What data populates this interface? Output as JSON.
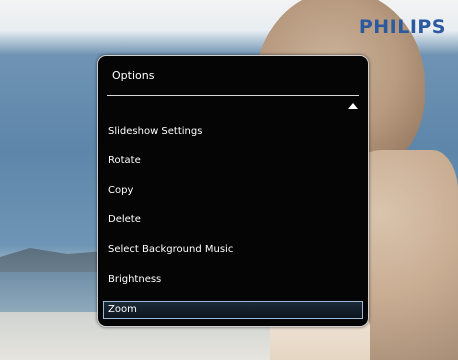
{
  "brand": {
    "name": "PHILIPS",
    "color": "#2b5aa0"
  },
  "menu": {
    "title": "Options",
    "scroll_indicator": "up-arrow-icon",
    "items": [
      {
        "label": "Slideshow Settings"
      },
      {
        "label": "Rotate"
      },
      {
        "label": "Copy"
      },
      {
        "label": "Delete"
      },
      {
        "label": "Select Background Music"
      },
      {
        "label": "Brightness"
      },
      {
        "label": "Zoom",
        "selected": true
      }
    ],
    "selected_index": 6,
    "highlight_color": "#9db9d8"
  }
}
